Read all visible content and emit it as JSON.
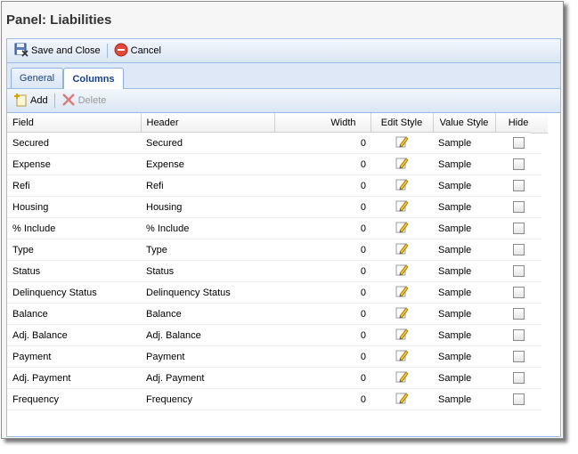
{
  "panel": {
    "title": "Panel: Liabilities"
  },
  "toolbar": {
    "save_close_label": "Save and Close",
    "cancel_label": "Cancel"
  },
  "tabs": [
    {
      "label": "General"
    },
    {
      "label": "Columns"
    }
  ],
  "grid_toolbar": {
    "add_label": "Add",
    "delete_label": "Delete"
  },
  "grid": {
    "columns": [
      "Field",
      "Header",
      "Width",
      "Edit Style",
      "Value Style",
      "Hide"
    ],
    "rows": [
      {
        "field": "Secured",
        "header": "Secured",
        "width": "0",
        "value_style": "Sample"
      },
      {
        "field": "Expense",
        "header": "Expense",
        "width": "0",
        "value_style": "Sample"
      },
      {
        "field": "Refi",
        "header": "Refi",
        "width": "0",
        "value_style": "Sample"
      },
      {
        "field": "Housing",
        "header": "Housing",
        "width": "0",
        "value_style": "Sample"
      },
      {
        "field": "% Include",
        "header": "% Include",
        "width": "0",
        "value_style": "Sample"
      },
      {
        "field": "Type",
        "header": "Type",
        "width": "0",
        "value_style": "Sample"
      },
      {
        "field": "Status",
        "header": "Status",
        "width": "0",
        "value_style": "Sample"
      },
      {
        "field": "Delinquency Status",
        "header": "Delinquency Status",
        "width": "0",
        "value_style": "Sample"
      },
      {
        "field": "Balance",
        "header": "Balance",
        "width": "0",
        "value_style": "Sample"
      },
      {
        "field": "Adj. Balance",
        "header": "Adj. Balance",
        "width": "0",
        "value_style": "Sample"
      },
      {
        "field": "Payment",
        "header": "Payment",
        "width": "0",
        "value_style": "Sample"
      },
      {
        "field": "Adj. Payment",
        "header": "Adj. Payment",
        "width": "0",
        "value_style": "Sample"
      },
      {
        "field": "Frequency",
        "header": "Frequency",
        "width": "0",
        "value_style": "Sample"
      }
    ]
  },
  "colors": {
    "accent": "#15428b",
    "border": "#99bbe8",
    "tabstrip": "#dfe8f6"
  },
  "icons": {
    "save_close": "save-close-icon",
    "cancel": "cancel-icon",
    "add": "add-icon",
    "delete": "delete-icon",
    "edit": "pencil-icon"
  }
}
